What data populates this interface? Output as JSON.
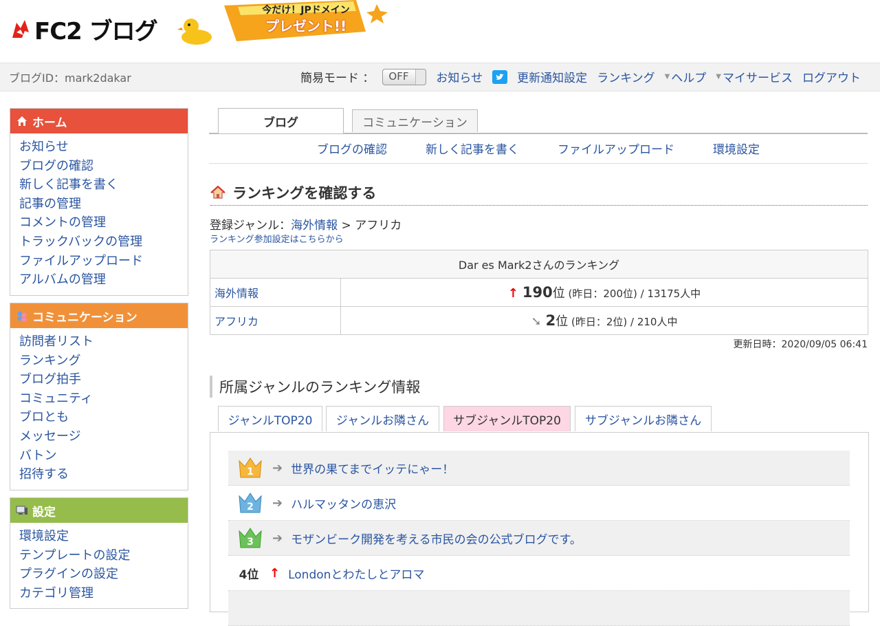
{
  "header": {
    "logo_text": "FC2 ブログ",
    "promo_line1": "今だけ！JPドメイン",
    "promo_line2": "プレゼント!!",
    "blog_id": "ブログID：mark2dakar"
  },
  "topnav": {
    "easy_mode_label": "簡易モード ：",
    "toggle_value": "OFF",
    "items": [
      "お知らせ",
      "更新通知設定",
      "ランキング",
      "ヘルプ",
      "マイサービス",
      "ログアウト"
    ]
  },
  "sidebar": {
    "home": {
      "title": "ホーム",
      "color": "#e8513b",
      "items": [
        "お知らせ",
        "ブログの確認",
        "新しく記事を書く",
        "記事の管理",
        "コメントの管理",
        "トラックバックの管理",
        "ファイルアップロード",
        "アルバムの管理"
      ]
    },
    "community": {
      "title": "コミュニケーション",
      "color": "#f0913a",
      "items": [
        "訪問者リスト",
        "ランキング",
        "ブログ拍手",
        "コミュニティ",
        "ブロとも",
        "メッセージ",
        "バトン",
        "招待する"
      ]
    },
    "settings": {
      "title": "設定",
      "color": "#96bc4c",
      "items": [
        "環境設定",
        "テンプレートの設定",
        "プラグインの設定",
        "カテゴリ管理"
      ]
    }
  },
  "main": {
    "tabs": [
      "ブログ",
      "コミュニケーション"
    ],
    "subnav": [
      "ブログの確認",
      "新しく記事を書く",
      "ファイルアップロード",
      "環境設定"
    ],
    "page_title": "ランキングを確認する",
    "genre_prefix": "登録ジャンル：",
    "genre_main": "海外情報",
    "genre_sep": " > ",
    "genre_sub": "アフリカ",
    "genre_settings_link": "ランキング参加設定はこちらから",
    "ranking_table": {
      "header": "Dar es Mark2さんのランキング",
      "rows": [
        {
          "genre": "海外情報",
          "rank": "190",
          "unit": "位",
          "detail": " (昨日：200位) / 13175人中",
          "trend": "up"
        },
        {
          "genre": "アフリカ",
          "rank": "2",
          "unit": "位",
          "detail": " (昨日：2位) / 210人中",
          "trend": "same"
        }
      ]
    },
    "updated": "更新日時：2020/09/05 06:41",
    "section_title": "所属ジャンルのランキング情報",
    "ranking_tabs": [
      "ジャンルTOP20",
      "ジャンルお隣さん",
      "サブジャンルTOP20",
      "サブジャンルお隣さん"
    ],
    "ranking_list": [
      {
        "rank": "1",
        "title": "世界の果てまでイッテにゃー！",
        "trend": "same"
      },
      {
        "rank": "2",
        "title": "ハルマッタンの恵沢",
        "trend": "same"
      },
      {
        "rank": "3",
        "title": "モザンビーク開発を考える市民の会の公式ブログです。",
        "trend": "same"
      },
      {
        "rank": "4位",
        "title": "Londonとわたしとアロマ",
        "trend": "up"
      }
    ]
  }
}
